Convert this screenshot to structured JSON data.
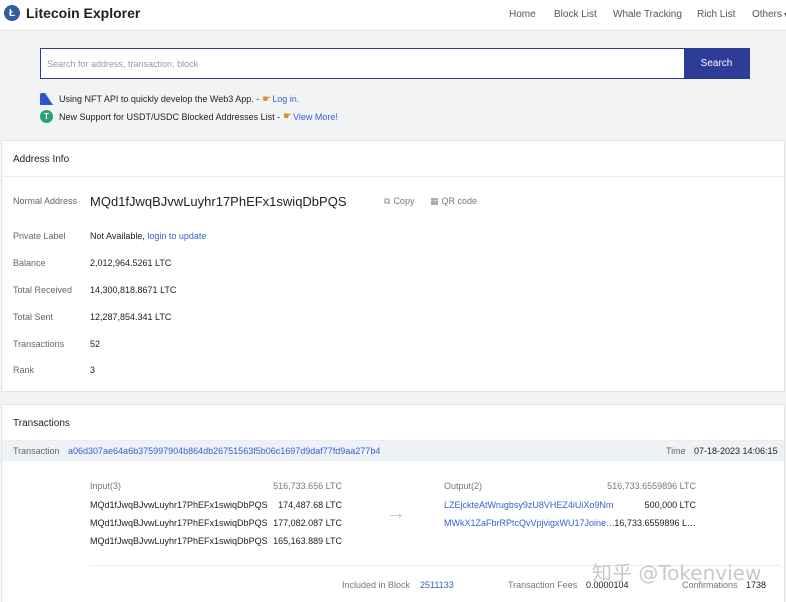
{
  "navbar": {
    "brand_logo": "Ł",
    "brand_name": "Litecoin Explorer",
    "items": [
      {
        "label": "Home"
      },
      {
        "label": "Block List"
      },
      {
        "label": "Whale Tracking"
      },
      {
        "label": "Rich List"
      },
      {
        "label": "Others"
      }
    ]
  },
  "search": {
    "placeholder": "Search for address, transaction, block",
    "button_label": "Search"
  },
  "notices": [
    {
      "text": "Using NFT API to quickly develop the Web3 App. -",
      "link_label": "Log in."
    },
    {
      "text": "New Support for USDT/USDC Blocked Addresses List -",
      "link_label": "View More!",
      "icon": "T"
    }
  ],
  "address_info": {
    "title": "Address Info",
    "normal_address_label": "Normal Address",
    "address": "MQd1fJwqBJvwLuyhr17PhEFx1swiqDbPQS",
    "copy_label": "Copy",
    "qr_label": "QR code",
    "private_label_label": "Private Label",
    "private_label_value": "Not Available,",
    "login_link": "login to update",
    "balance_label": "Balance",
    "balance": "2,012,964.5261 LTC",
    "total_received_label": "Total Received",
    "total_received": "14,300,818.8671 LTC",
    "total_sent_label": "Total Sent",
    "total_sent": "12,287,854.341 LTC",
    "transactions_label": "Transactions",
    "transactions": "52",
    "rank_label": "Rank",
    "rank": "3"
  },
  "transactions": {
    "title": "Transactions",
    "tx_label": "Transaction",
    "tx_hash": "a06d307ae64a6b375997904b864db26751563f5b06c1697d9daf77fd9aa277b4",
    "time_label": "Time",
    "time": "07-18-2023 14:06:15",
    "input_label": "Input(3)",
    "input_total": "516,733.656 LTC",
    "inputs": [
      {
        "address": "MQd1fJwqBJvwLuyhr17PhEFx1swiqDbPQS",
        "amount": "174,487.68 LTC"
      },
      {
        "address": "MQd1fJwqBJvwLuyhr17PhEFx1swiqDbPQS",
        "amount": "177,082.087 LTC"
      },
      {
        "address": "MQd1fJwqBJvwLuyhr17PhEFx1swiqDbPQS",
        "amount": "165,163.889 LTC"
      }
    ],
    "output_label": "Output(2)",
    "output_total": "516,733.6559896 LTC",
    "outputs": [
      {
        "address": "LZEjckteAtWrugbsy9zU8VHEZ4iUiXo9Nm",
        "amount": "500,000 LTC"
      },
      {
        "address": "MWkX1ZaFbrRPtcQvVpjvigxWU17Joine…",
        "amount": "16,733.6559896 L…"
      }
    ],
    "included_in_block_label": "Included in Block",
    "block": "2511133",
    "fees_label": "Transaction Fees",
    "fees": "0.0000104",
    "confirmations_label": "Confirmations",
    "confirmations": "1738"
  },
  "watermark": "知乎 @Tokenview"
}
